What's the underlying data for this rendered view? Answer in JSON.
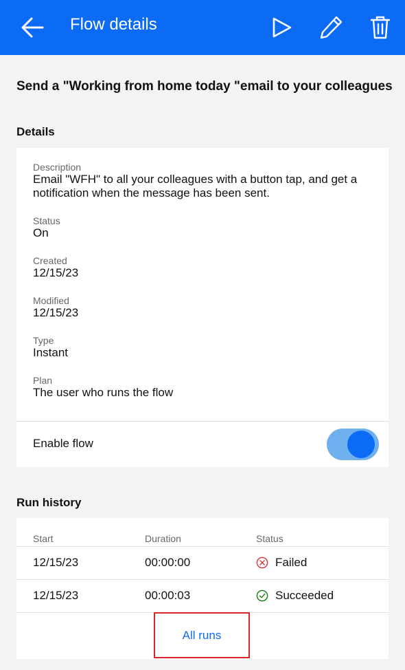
{
  "header": {
    "title": "Flow details",
    "icons": [
      "back-arrow-icon",
      "play-icon",
      "pencil-icon",
      "trash-icon"
    ],
    "background_color": "#0b6bf5"
  },
  "flow": {
    "title": "Send a \"Working from home today \"email to your colleagues"
  },
  "details": {
    "heading": "Details",
    "description_label": "Description",
    "description_value": "Email \"WFH\" to all your colleagues with a button tap, and get a notification when the message has been sent.",
    "status_label": "Status",
    "status_value": "On",
    "created_label": "Created",
    "created_value": "12/15/23",
    "modified_label": "Modified",
    "modified_value": "12/15/23",
    "type_label": "Type",
    "type_value": "Instant",
    "plan_label": "Plan",
    "plan_value": "The user who runs the flow",
    "enable_label": "Enable flow",
    "enable_on": true
  },
  "run_history": {
    "heading": "Run history",
    "columns": [
      "Start",
      "Duration",
      "Status"
    ],
    "rows": [
      {
        "start": "12/15/23",
        "duration": "00:00:00",
        "status": "Failed",
        "icon": "failed-x-circle-icon",
        "color": "#d13438"
      },
      {
        "start": "12/15/23",
        "duration": "00:00:03",
        "status": "Succeeded",
        "icon": "success-check-circle-icon",
        "color": "#107c10"
      }
    ],
    "all_runs_label": "All runs"
  },
  "colors": {
    "accent": "#0b6bf5",
    "toggle_track": "#6fb1ef",
    "failed": "#d13438",
    "succeeded": "#107c10",
    "highlight_box": "#d9262b"
  }
}
